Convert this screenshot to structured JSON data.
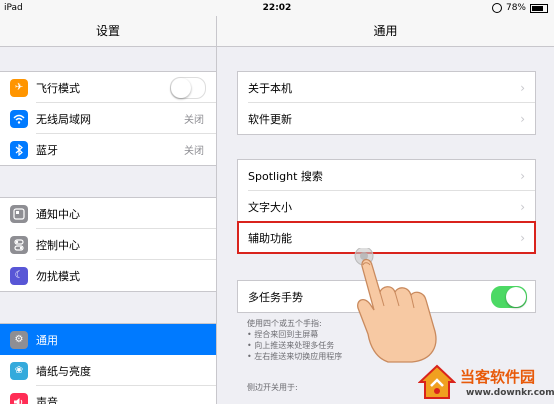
{
  "status_bar": {
    "device": "iPad",
    "time": "22:02",
    "battery": "78%",
    "battery_level": 0.78
  },
  "sidebar": {
    "title": "设置",
    "groups": [
      {
        "items": [
          {
            "label": "飞行模式",
            "icon": "airplane-icon",
            "color": "#ff9500",
            "toggle": false
          },
          {
            "label": "无线局域网",
            "icon": "wifi-icon",
            "color": "#007aff",
            "value": "关闭"
          },
          {
            "label": "蓝牙",
            "icon": "bluetooth-icon",
            "color": "#007aff",
            "value": "关闭"
          }
        ]
      },
      {
        "items": [
          {
            "label": "通知中心",
            "icon": "notification-center-icon",
            "color": "#8e8e93"
          },
          {
            "label": "控制中心",
            "icon": "control-center-icon",
            "color": "#8e8e93"
          },
          {
            "label": "勿扰模式",
            "icon": "moon-icon",
            "color": "#5856d6"
          }
        ]
      },
      {
        "items": [
          {
            "label": "通用",
            "icon": "gear-icon",
            "color": "#8e8e93",
            "selected": true
          },
          {
            "label": "墙纸与亮度",
            "icon": "wallpaper-icon",
            "color": "#34aadc"
          },
          {
            "label": "声音",
            "icon": "speaker-icon",
            "color": "#ff2d55"
          }
        ]
      }
    ]
  },
  "main": {
    "title": "通用",
    "group1": [
      "关于本机",
      "软件更新"
    ],
    "group2": [
      "Spotlight 搜索",
      "文字大小",
      "辅助功能"
    ],
    "multitask": {
      "label": "多任务手势",
      "on": true
    },
    "note_lines": [
      "使用四个或五个手指:",
      "• 捏合来回到主屏幕",
      "• 向上推送来处理多任务",
      "• 左右推送来切换应用程序"
    ],
    "side_switch_label": "侧边开关用于:"
  },
  "watermark": {
    "name": "当客软件园",
    "url": "www.downkr.com"
  },
  "colors": {
    "accent": "#007aff",
    "switch_on": "#4cd964",
    "highlight": "#d9231c"
  }
}
